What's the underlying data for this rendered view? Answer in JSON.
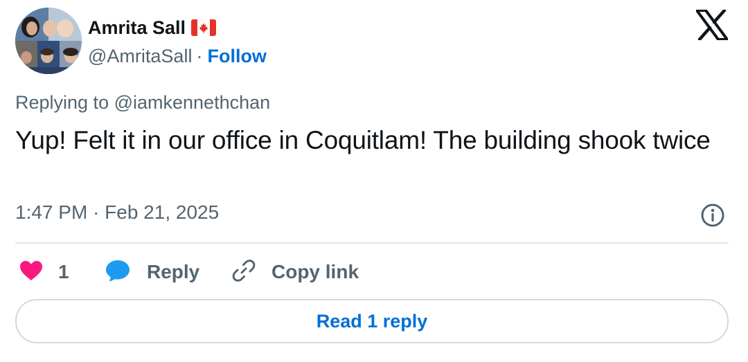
{
  "author": {
    "name": "Amrita Sall",
    "flag_icon": "canada-flag-icon",
    "handle": "@AmritaSall",
    "separator": "·",
    "follow_label": "Follow"
  },
  "platform_icon": "x-logo-icon",
  "tweet": {
    "replying_prefix": "Replying to ",
    "replying_to": "@iamkennethchan",
    "text": "Yup! Felt it in our office in Coquitlam! The building shook twice",
    "timestamp": "1:47 PM · Feb 21, 2025"
  },
  "actions": {
    "like_count": "1",
    "reply_label": "Reply",
    "copy_link_label": "Copy link"
  },
  "read_replies_label": "Read 1 reply",
  "colors": {
    "text": "#0f1419",
    "secondary": "#536471",
    "link": "#006fd6",
    "like": "#f91880",
    "reply": "#1d9bf0",
    "border": "#cfd9de"
  }
}
